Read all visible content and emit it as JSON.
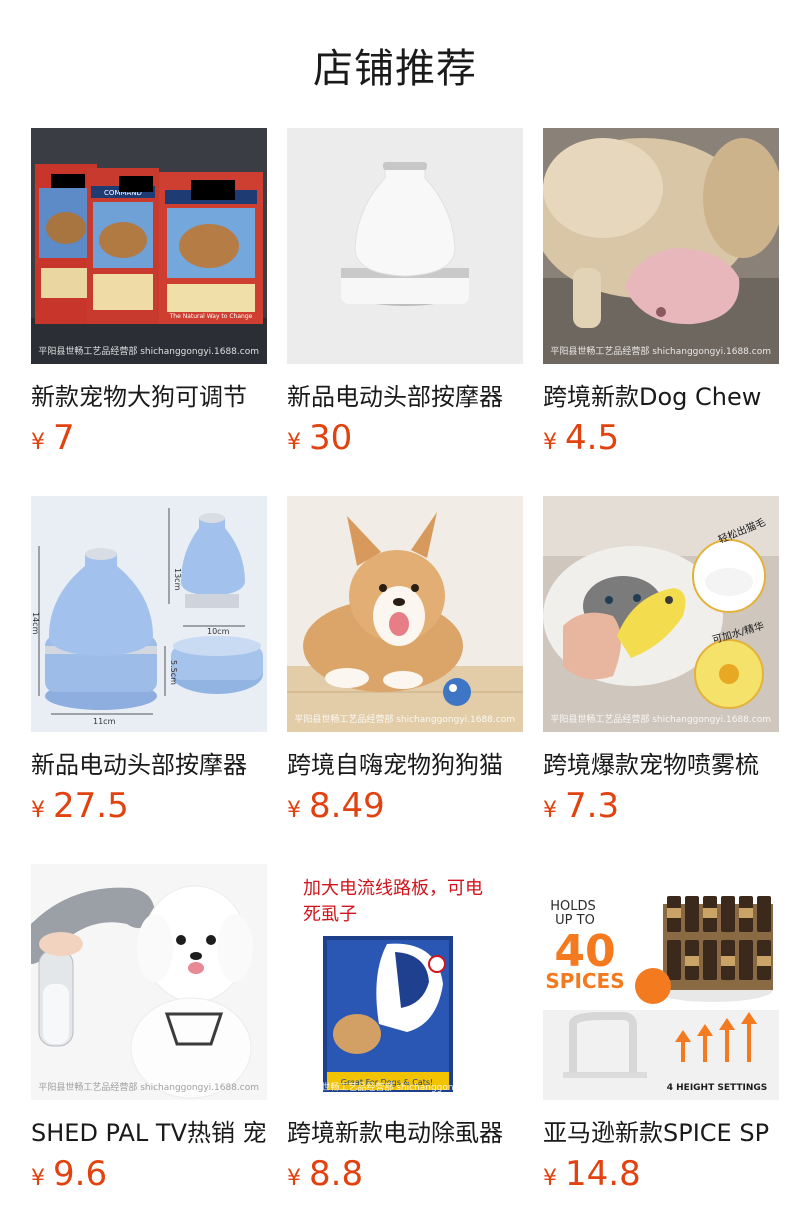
{
  "header": {
    "title": "店铺推荐"
  },
  "products": [
    {
      "name": "新款宠物大狗可调节",
      "currency": "¥",
      "price": "7",
      "watermark": "平阳县世畅工艺品经营部 shichanggongyi.1688.com"
    },
    {
      "name": "新品电动头部按摩器",
      "currency": "¥",
      "price": "30",
      "watermark": ""
    },
    {
      "name": "跨境新款Dog Chew",
      "currency": "¥",
      "price": "4.5",
      "watermark": "平阳县世畅工艺品经营部 shichanggongyi.1688.com"
    },
    {
      "name": "新品电动头部按摩器",
      "currency": "¥",
      "price": "27.5",
      "watermark": ""
    },
    {
      "name": "跨境自嗨宠物狗狗猫",
      "currency": "¥",
      "price": "8.49",
      "watermark": "平阳县世畅工艺品经营部 shichanggongyi.1688.com"
    },
    {
      "name": "跨境爆款宠物喷雾梳",
      "currency": "¥",
      "price": "7.3",
      "watermark": "平阳县世畅工艺品经营部 shichanggongyi.1688.com"
    },
    {
      "name": "SHED PAL TV热销 宠",
      "currency": "¥",
      "price": "9.6",
      "watermark": "平阳县世畅工艺品经营部 shichanggongyi.1688.com"
    },
    {
      "name": "跨境新款电动除虱器",
      "currency": "¥",
      "price": "8.8",
      "watermark": "平阳县世畅工艺品经营部 shichanggongyi.1688.com"
    },
    {
      "name": "亚马逊新款SPICE SP",
      "currency": "¥",
      "price": "14.8",
      "watermark": ""
    }
  ],
  "image_text": {
    "box_brand": "COMMAND",
    "box_tagline": "The Natural Way to Change",
    "massager_dims": [
      "13cm",
      "14cm",
      "10cm",
      "5.5cm",
      "11cm"
    ],
    "brush_labels": [
      "轻松出猫毛",
      "可加水/精华"
    ],
    "flea_caption": "加大电流线路板，可电死虱子",
    "flea_box_footer": "Great For Dogs & Cats!",
    "spice_headline": [
      "HOLDS",
      "UP TO",
      "40",
      "SPICES"
    ],
    "spice_settings": "4 HEIGHT SETTINGS"
  },
  "colors": {
    "price": "#e2420f",
    "massager_white": "#f4f4f4",
    "massager_blue": "#9ab8e6",
    "chew_pink": "#e6b2b8",
    "spice_orange": "#f47a20"
  }
}
